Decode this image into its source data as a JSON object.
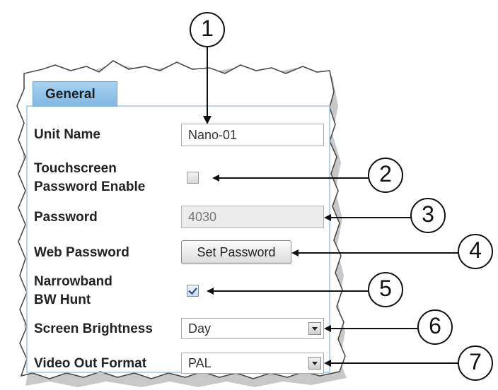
{
  "tab": {
    "label": "General"
  },
  "fields": {
    "unit_name": {
      "label": "Unit Name",
      "value": "Nano-01"
    },
    "touchscreen": {
      "label_line1": "Touchscreen",
      "label_line2": "Password Enable",
      "checked": false
    },
    "password": {
      "label": "Password",
      "value": "4030",
      "disabled": true
    },
    "web_password": {
      "label": "Web Password",
      "button": "Set Password"
    },
    "narrowband": {
      "label_line1": "Narrowband",
      "label_line2": "BW Hunt",
      "checked": true
    },
    "screen_brightness": {
      "label": "Screen Brightness",
      "value": "Day"
    },
    "video_out": {
      "label": "Video Out Format",
      "value": "PAL"
    }
  },
  "callouts": [
    "1",
    "2",
    "3",
    "4",
    "5",
    "6",
    "7"
  ],
  "colors": {
    "tab_fill": "#8fc3ea",
    "panel_border": "#9dc3e6",
    "disabled_field": "#ececec"
  }
}
